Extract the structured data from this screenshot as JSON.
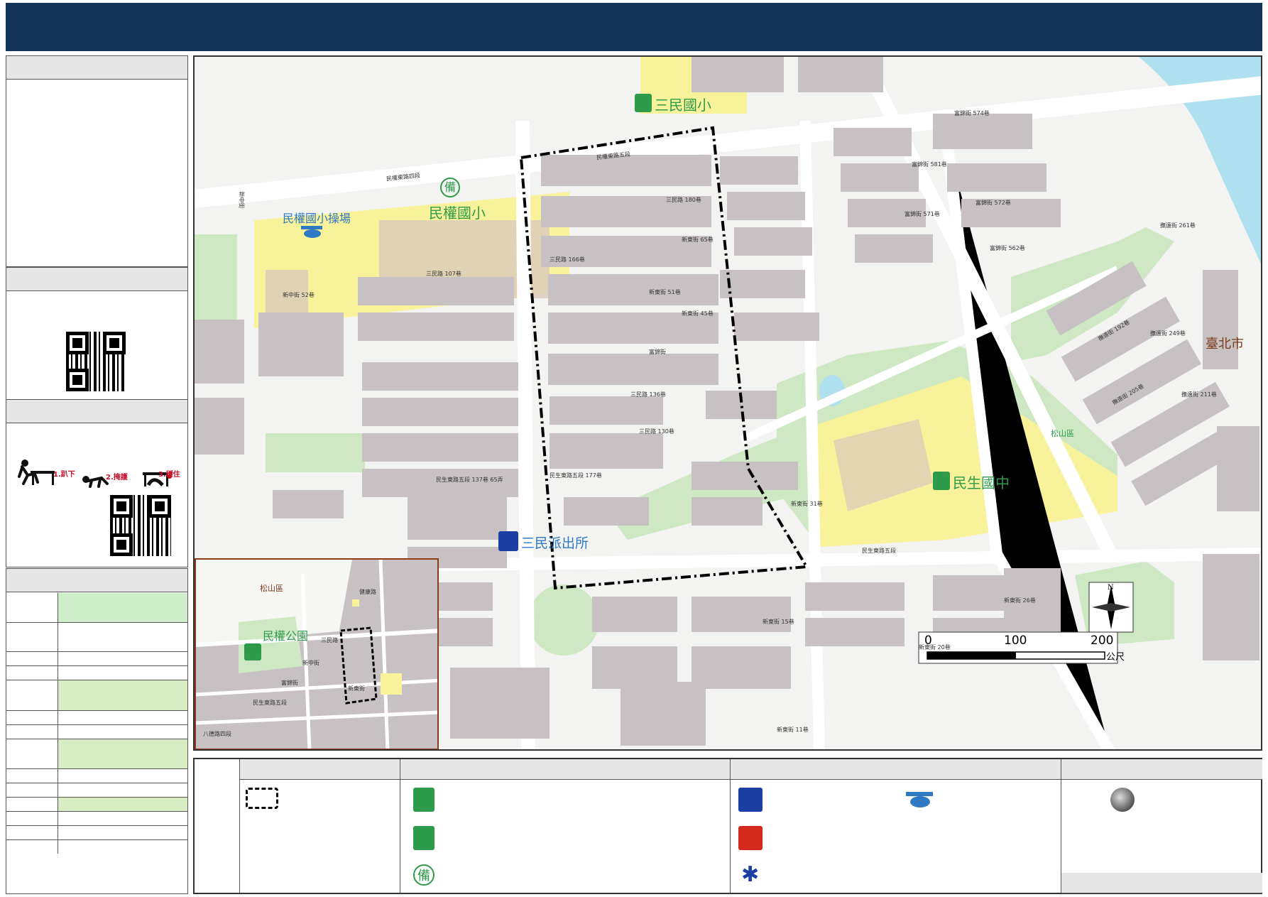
{
  "colors": {
    "header": "#13335a",
    "school": "#f8f29a",
    "park": "#cfe8c4",
    "building": "#c7c1c3",
    "road": "#ffffff",
    "boundary": "#000000",
    "water": "#aee0ef",
    "label_green": "#2e9b4a",
    "label_blue": "#2f78c4",
    "label_brown": "#7a3b1a"
  },
  "map": {
    "labels": {
      "sanmin_elementary": "三民國小",
      "minquan_elementary": "民權國小",
      "minquan_field": "民權國小操場",
      "minsheng_junior": "民生國中",
      "sanmin_police": "三民派出所",
      "taipei_city": "臺北市",
      "songshan_district": "松山區",
      "standby_char": "備"
    },
    "streets": [
      "民權東路五段",
      "民權東路四段",
      "新中街",
      "三民路 180巷",
      "三民路 166巷",
      "三民路 107巷",
      "新中街 52巷",
      "新東街 65巷",
      "新東街 51巷",
      "新東街 45巷",
      "富錦街",
      "三民路 136巷",
      "三民路 130巷",
      "民生東路五段 177巷",
      "民生東路五段 137巷 65弄",
      "新東街 31巷",
      "民生東路五段",
      "富錦街 574巷",
      "富錦街 581巷",
      "富錦街 572巷",
      "富錦街 571巷",
      "富錦街 562巷",
      "新東街 26巷",
      "新東街 20巷",
      "新東街 11巷",
      "新東街 15巷",
      "撫遠街 261巷",
      "撫遠街 249巷",
      "撫遠街 211巷",
      "撫遠街 192巷",
      "撫遠街 205巷"
    ],
    "scale": {
      "t0": "0",
      "t1": "100",
      "t2": "200",
      "unit": "公尺"
    },
    "compass": "N",
    "inset": {
      "park_label": "民權公園",
      "district": "松山區",
      "streets": [
        "新中街",
        "健康路",
        "三民路",
        "新東街",
        "富錦街",
        "民生東路五段",
        "八德路四段"
      ]
    }
  },
  "sidebar": {
    "drill_steps": [
      "1.趴下",
      "2.掩護",
      "3.穩住"
    ]
  },
  "legend": {
    "icons": [
      "boundary-icon",
      "shelter-school-icon",
      "evacuation-park-icon",
      "standby-icon",
      "police-icon",
      "helipad-icon",
      "fire-station-icon",
      "medical-icon",
      "location-pin-icon"
    ],
    "standby_char": "備"
  }
}
